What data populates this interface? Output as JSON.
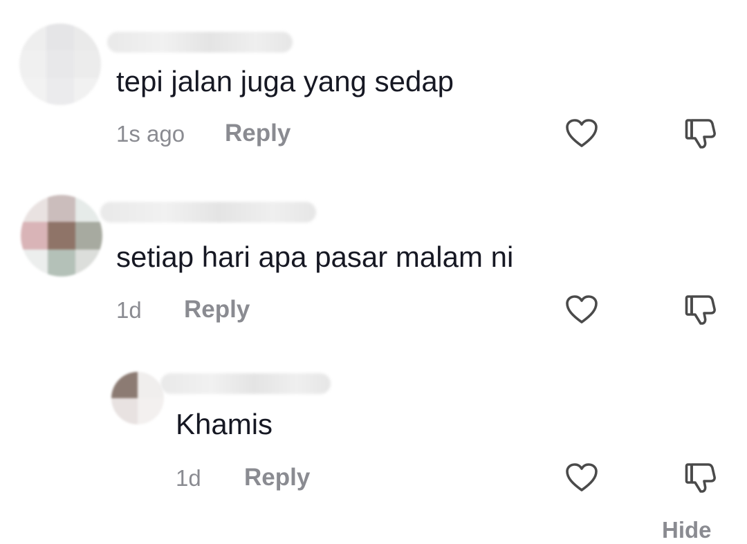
{
  "comments": [
    {
      "text": "tepi jalan juga yang sedap",
      "time": "1s ago",
      "reply_label": "Reply",
      "avatar_colors": [
        "#eeeeee",
        "#e5e5e7",
        "#eaeaea",
        "#f0f0f0",
        "#e8e8ea",
        "#ececec",
        "#f2f2f2",
        "#ebebed",
        "#f1f1f1"
      ]
    },
    {
      "text": "setiap hari apa pasar malam ni",
      "time": "1d",
      "reply_label": "Reply",
      "avatar_colors": [
        "#e9e2e1",
        "#cbbdbc",
        "#e6ebe9",
        "#d9b4b7",
        "#8f7468",
        "#a7aaa0",
        "#eceeed",
        "#b4c1b8",
        "#dcdedb"
      ]
    }
  ],
  "reply": {
    "text": "Khamis",
    "time": "1d",
    "reply_label": "Reply",
    "avatar_colors": [
      "#8c7b73",
      "#f0eeed",
      "#e8e2e1",
      "#f3f0ef"
    ]
  },
  "hide_label": "Hide",
  "colors": {
    "text": "#161823",
    "muted": "#8a8b91",
    "icon": "#4a4a4a"
  },
  "icons": {
    "like": "heart-outline-icon",
    "dislike": "thumbs-down-outline-icon"
  }
}
